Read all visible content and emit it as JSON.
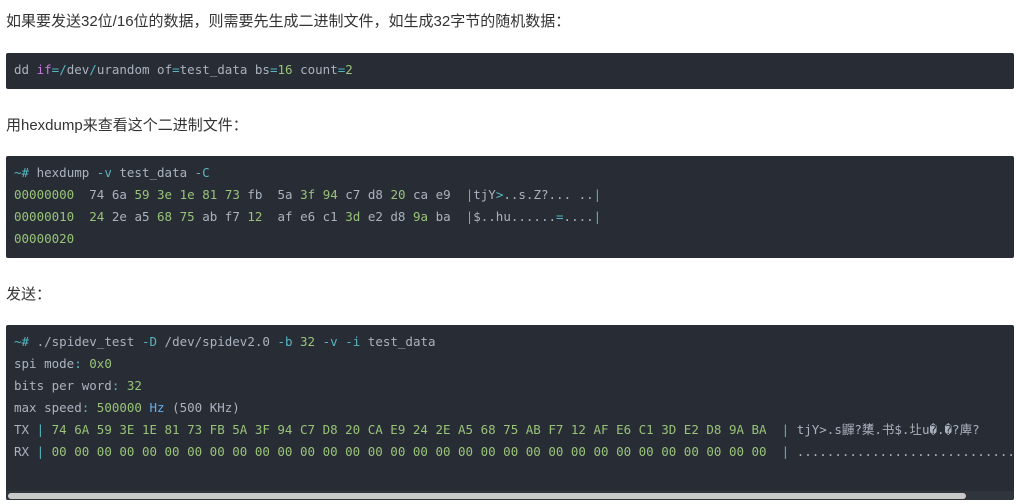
{
  "paragraphs": {
    "intro": "如果要发送32位/16位的数据，则需要先生成二进制文件，如生成32字节的随机数据：",
    "hexdump_intro": "用hexdump来查看这个二进制文件：",
    "send_intro": "发送："
  },
  "code_dd": {
    "cmd": "dd",
    "if_kw": "if",
    "eq": "=",
    "slash1": "/",
    "dev": "dev",
    "slash2": "/",
    "urandom": "urandom",
    "of_kw": "of",
    "eq2": "=",
    "of_val": "test_data",
    "bs_kw": "bs",
    "eq3": "=",
    "bs_val": "16",
    "count_kw": "count",
    "eq4": "=",
    "count_val": "2"
  },
  "code_hexdump": {
    "prompt": "~#",
    "cmd": " hexdump ",
    "opt_v": "-v",
    "file": " test_data ",
    "opt_C": "-C",
    "row1": {
      "offset": "00000000",
      "p1": "  74 6a ",
      "n1": "59",
      "p2": " ",
      "n2": "3e",
      "p3": " ",
      "n3": "1e",
      "p4": " ",
      "n4": "81",
      "p5": " ",
      "n5": "73",
      "p6": " fb  5a ",
      "n6": "3f",
      "p7": " ",
      "n7": "94",
      "p8": " c7 d8 ",
      "n8": "20",
      "p9": " ca e9  ",
      "bar1": "|",
      "ascii": "tjY",
      "gt": ">",
      "ascii2": "..s.Z?... ..",
      "bar2": "|"
    },
    "row2": {
      "offset": "00000010",
      "p1": "  ",
      "n1": "24",
      "p2": " 2e a5 ",
      "n2": "68",
      "p3": " ",
      "n3": "75",
      "p4": " ab f7 ",
      "n4": "12",
      "p5": "  af e6 c1 ",
      "n5": "3d",
      "p6": " e2 d8 ",
      "n6": "9a",
      "p7": " ba  ",
      "bar1": "|",
      "ascii": "$..hu......",
      "eq": "=",
      "ascii2": "....",
      "bar2": "|"
    },
    "row3": {
      "offset": "00000020"
    }
  },
  "code_spidev": {
    "prompt": "~#",
    "cmd": " ./spidev_test ",
    "opt_D": "-D",
    "path1": " /dev/",
    "path2": "spidev2.0",
    "sp1": " ",
    "opt_b": "-b",
    "sp2": " ",
    "bits": "32",
    "sp3": " ",
    "opt_v": "-v",
    "sp4": " ",
    "opt_i": "-i",
    "file": " test_data",
    "mode_label": "spi mode",
    "mode_colon": ": ",
    "mode_val": "0x0",
    "bpw_label": "bits per word",
    "bpw_colon": ": ",
    "bpw_val": "32",
    "speed_label": "max speed",
    "speed_colon": ": ",
    "speed_val": "500000",
    "speed_sp": " ",
    "speed_unit": "Hz",
    "speed_paren": " (500 KHz)",
    "tx_label": "TX",
    "tx_sep": " | ",
    "tx_hex": "74 6A 59 3E 1E 81 73 FB 5A 3F 94 C7 D8 20 CA E9 24 2E A5 68 75 AB F7 12 AF E6 C1 3D E2 D8 9A BA",
    "tx_sep2": "  | ",
    "tx_ascii": "tjY>.s鼲?橥.书$.圵u�.�?庳?",
    "rx_label": "RX",
    "rx_sep": " | ",
    "rx_hex": "00 00 00 00 00 00 00 00 00 00 00 00 00 00 00 00 00 00 00 00 00 00 00 00 00 00 00 00 00 00 00 00",
    "rx_sep2": "  | ",
    "rx_ascii": "................................"
  }
}
